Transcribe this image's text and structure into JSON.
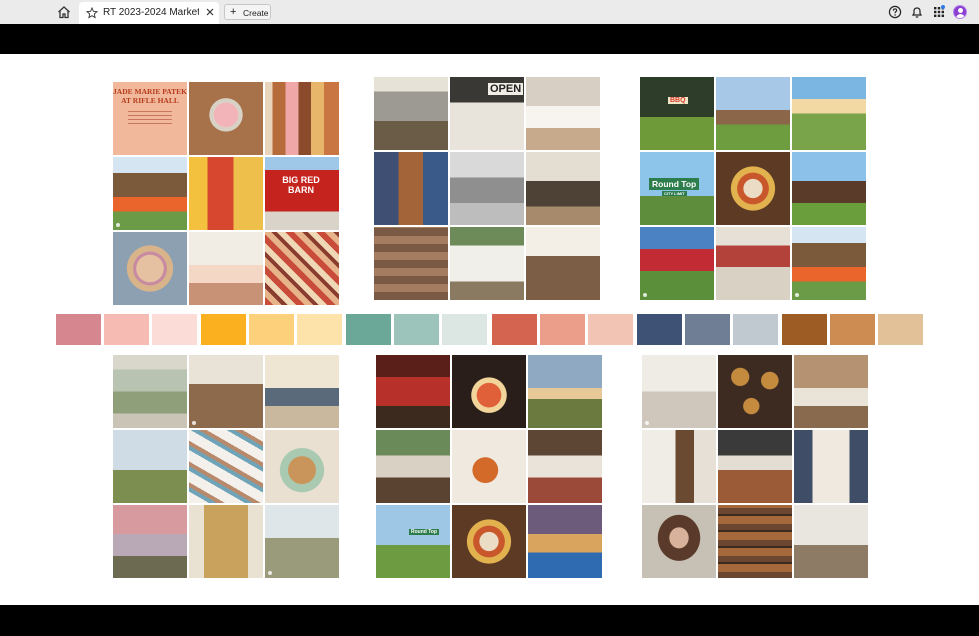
{
  "toolbar": {
    "tab_title": "RT 2023-2024 Marketi...",
    "create_label": "Create",
    "icons": [
      "home-icon",
      "star-icon",
      "close-icon",
      "plus-icon",
      "help-icon",
      "bell-icon",
      "apps-grid-icon",
      "avatar"
    ]
  },
  "board": {
    "poster_text": "JADE MARIE PATEK AT RIFLE HALL",
    "sign_open": "OPEN",
    "sign_bbq": "BBQ",
    "sign_big_red_barn": "BIG RED BARN",
    "sign_round_top": "Round Top",
    "sign_round_top_small": "CITY LIMIT",
    "sign_round_top_2": "Round Top",
    "palette_colors": [
      "#d6868e",
      "#f6bbb3",
      "#fbdcd6",
      "#fbb01f",
      "#fdd07c",
      "#fde3a9",
      "#6ba897",
      "#9cc4ba",
      "#dce7e3",
      "#d46450",
      "#eb9f8a",
      "#f1c4b3",
      "#3d5275",
      "#6f7d95",
      "#c0c8d0",
      "#9c5c24",
      "#cd8d52",
      "#e3c198"
    ]
  }
}
